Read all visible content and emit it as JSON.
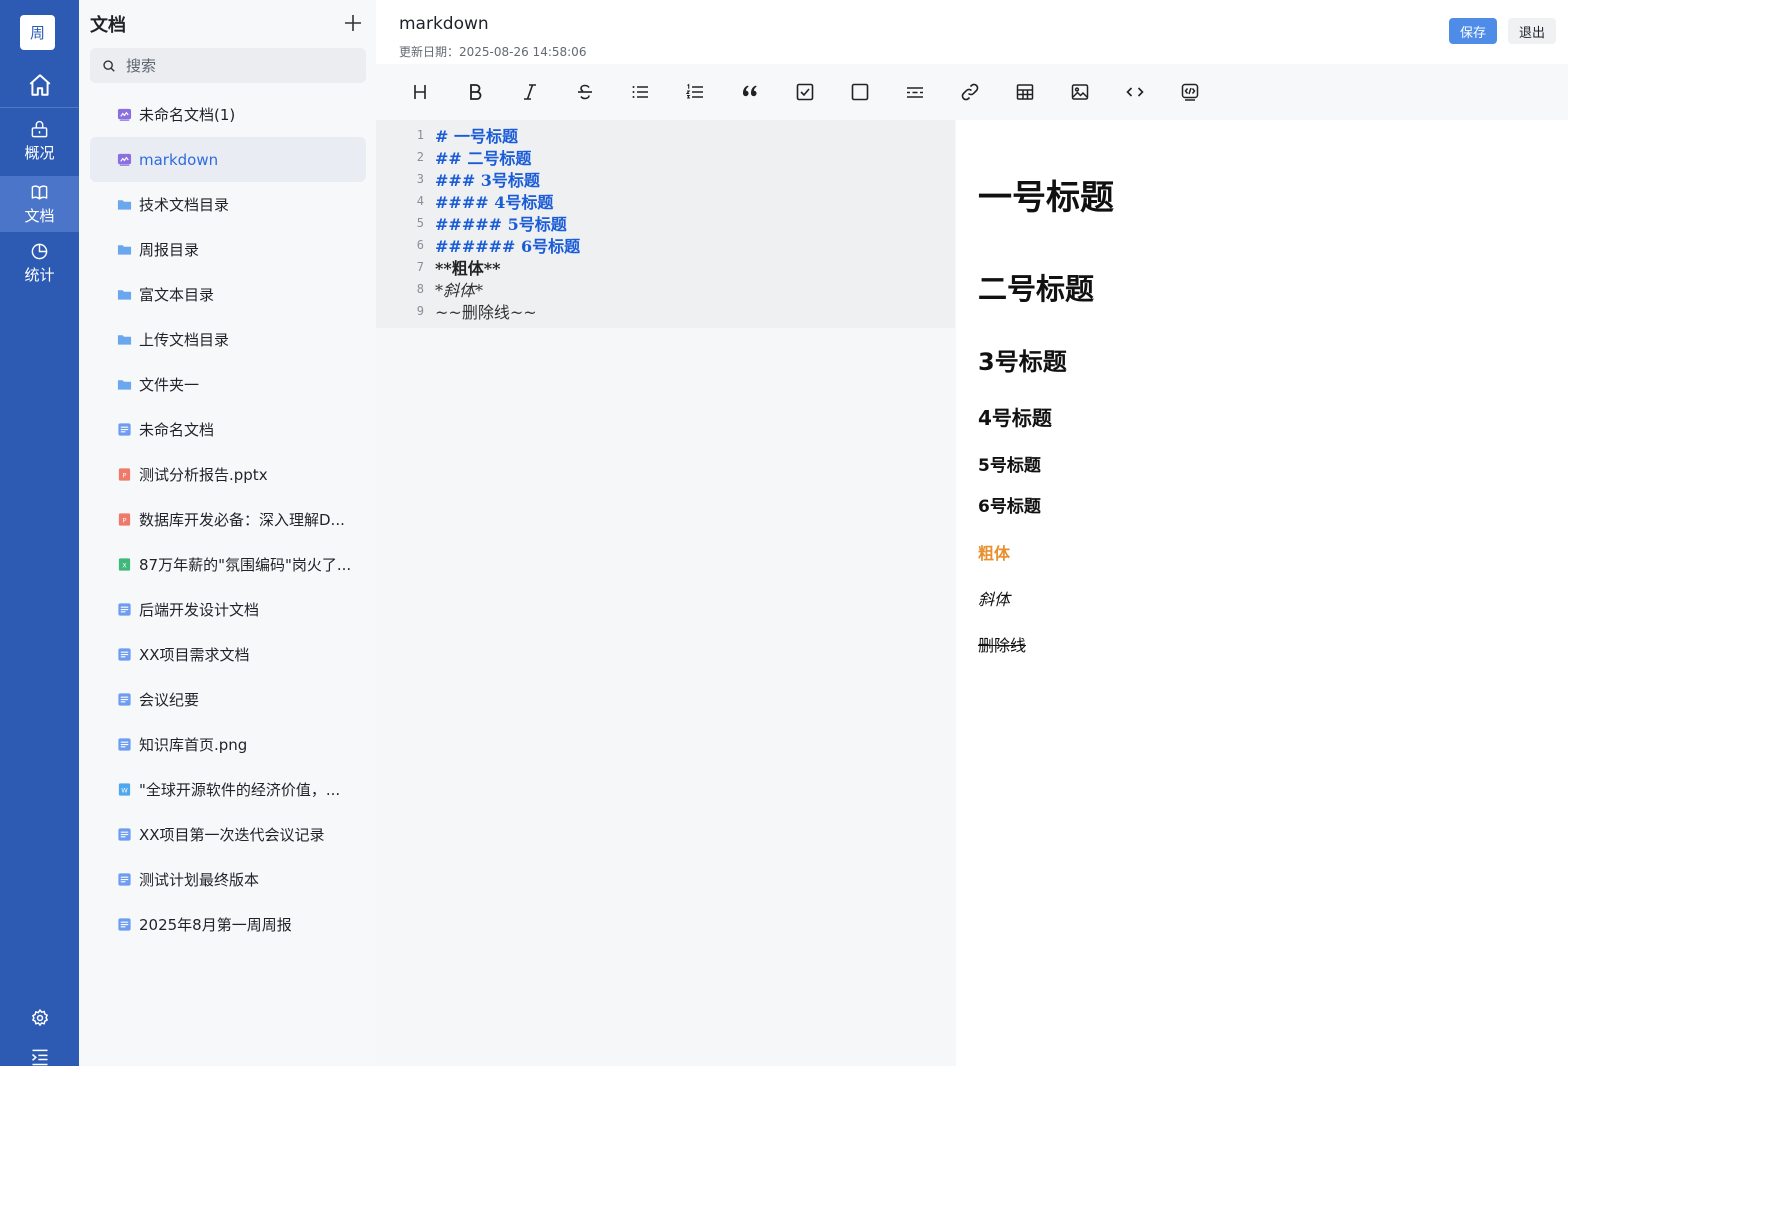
{
  "nav": {
    "avatar": "周",
    "items": [
      {
        "label": "概况"
      },
      {
        "label": "文档"
      },
      {
        "label": "统计"
      }
    ]
  },
  "sidebar": {
    "title": "文档",
    "search_placeholder": "搜索",
    "items": [
      {
        "label": "未命名文档(1)",
        "icon": "markdown-doc-icon"
      },
      {
        "label": "markdown",
        "icon": "markdown-doc-icon"
      },
      {
        "label": "技术文档目录",
        "icon": "folder-icon"
      },
      {
        "label": "周报目录",
        "icon": "folder-icon"
      },
      {
        "label": "富文本目录",
        "icon": "folder-icon"
      },
      {
        "label": "上传文档目录",
        "icon": "folder-icon"
      },
      {
        "label": "文件夹一",
        "icon": "folder-icon"
      },
      {
        "label": "未命名文档",
        "icon": "doc-icon"
      },
      {
        "label": "测试分析报告.pptx",
        "icon": "ppt-icon"
      },
      {
        "label": "数据库开发必备：深入理解D...",
        "icon": "ppt-icon"
      },
      {
        "label": "87万年薪的\"氛围编码\"岗火了...",
        "icon": "excel-icon"
      },
      {
        "label": "后端开发设计文档",
        "icon": "doc-icon"
      },
      {
        "label": "XX项目需求文档",
        "icon": "doc-icon"
      },
      {
        "label": "会议纪要",
        "icon": "doc-icon"
      },
      {
        "label": "知识库首页.png",
        "icon": "doc-icon"
      },
      {
        "label": "\"全球开源软件的经济价值，...",
        "icon": "word-icon"
      },
      {
        "label": "XX项目第一次迭代会议记录",
        "icon": "doc-icon"
      },
      {
        "label": "测试计划最终版本",
        "icon": "doc-icon"
      },
      {
        "label": "2025年8月第一周周报",
        "icon": "doc-icon"
      }
    ]
  },
  "header": {
    "title": "markdown",
    "updated": "更新日期：2025-08-26 14:58:06",
    "save_label": "保存",
    "exit_label": "退出"
  },
  "editor": {
    "lines": [
      {
        "n": "1",
        "text": "# 一号标题"
      },
      {
        "n": "2",
        "text": "## 二号标题"
      },
      {
        "n": "3",
        "text": "### 3号标题"
      },
      {
        "n": "4",
        "text": "#### 4号标题"
      },
      {
        "n": "5",
        "text": "##### 5号标题"
      },
      {
        "n": "6",
        "text": "###### 6号标题"
      },
      {
        "n": "7",
        "text": "**粗体**"
      },
      {
        "n": "8",
        "text": "*斜体*"
      },
      {
        "n": "9",
        "text": "~~删除线~~"
      }
    ]
  },
  "preview": {
    "h1": "一号标题",
    "h2": "二号标题",
    "h3": "3号标题",
    "h4": "4号标题",
    "h5": "5号标题",
    "h6": "6号标题",
    "bold": "粗体",
    "italic": "斜体",
    "strike": "删除线"
  },
  "colors": {
    "nav_bg": "#2d5bb4",
    "accent": "#4e8ce8",
    "heading_code": "#1a5cd8",
    "bold_preview": "#e8902e"
  }
}
